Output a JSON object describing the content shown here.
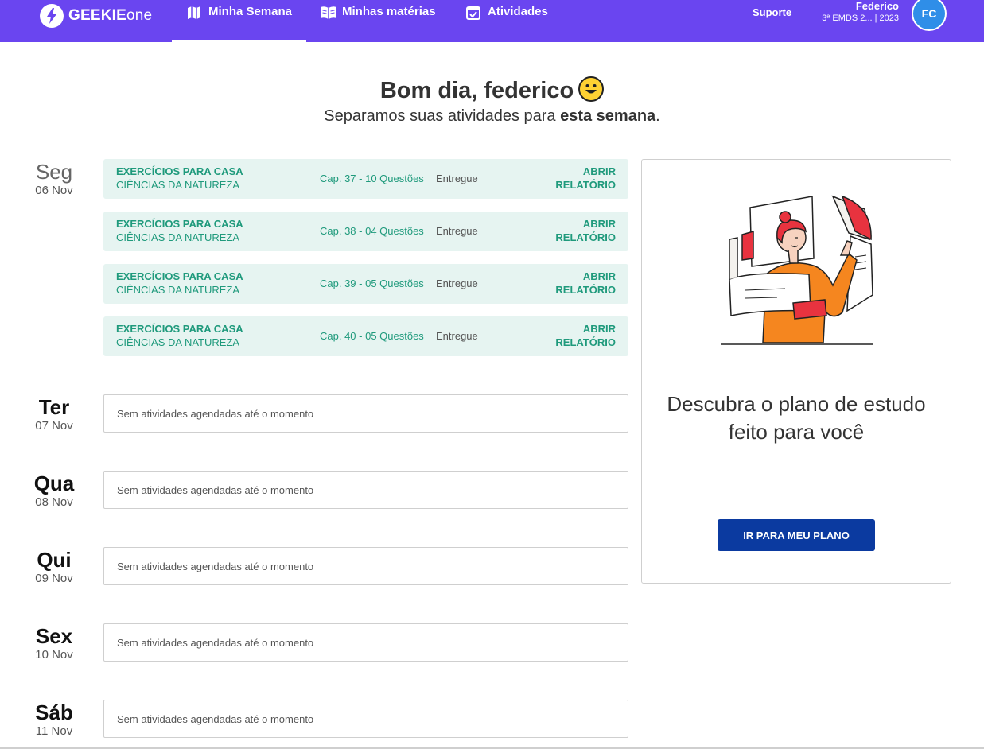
{
  "header": {
    "logo_bold": "GEEKIE",
    "logo_light": "one",
    "nav": [
      {
        "label": "Minha Semana",
        "icon": "map-icon",
        "active": true
      },
      {
        "label": "Minhas matérias",
        "icon": "book-icon",
        "active": false
      },
      {
        "label": "Atividades",
        "icon": "calendar-check-icon",
        "active": false
      }
    ],
    "support_label": "Suporte",
    "user_name": "Federico",
    "user_class": "3ª EMDS 2...   | 2023",
    "avatar_initials": "FC",
    "colors": {
      "bar": "#6a45f0",
      "avatar": "#2f8ee8"
    }
  },
  "greeting": {
    "title": "Bom dia, federico",
    "subtitle_prefix": "Separamos suas atividades para ",
    "subtitle_bold": "esta semana",
    "subtitle_suffix": "."
  },
  "days": [
    {
      "name": "Seg",
      "date": "06 Nov"
    },
    {
      "name": "Ter",
      "date": "07 Nov"
    },
    {
      "name": "Qua",
      "date": "08 Nov"
    },
    {
      "name": "Qui",
      "date": "09 Nov"
    },
    {
      "name": "Sex",
      "date": "10 Nov"
    },
    {
      "name": "Sáb",
      "date": "11 Nov"
    }
  ],
  "activities": [
    {
      "type": "EXERCÍCIOS PARA CASA",
      "subject": "CIÊNCIAS DA NATUREZA",
      "chapter": "Cap. 37 - 10 Questões",
      "status": "Entregue",
      "action_line1": "ABRIR",
      "action_line2": "RELATÓRIO"
    },
    {
      "type": "EXERCÍCIOS PARA CASA",
      "subject": "CIÊNCIAS DA NATUREZA",
      "chapter": "Cap. 38 - 04 Questões",
      "status": "Entregue",
      "action_line1": "ABRIR",
      "action_line2": "RELATÓRIO"
    },
    {
      "type": "EXERCÍCIOS PARA CASA",
      "subject": "CIÊNCIAS DA NATUREZA",
      "chapter": "Cap. 39 - 05 Questões",
      "status": "Entregue",
      "action_line1": "ABRIR",
      "action_line2": "RELATÓRIO"
    },
    {
      "type": "EXERCÍCIOS PARA CASA",
      "subject": "CIÊNCIAS DA NATUREZA",
      "chapter": "Cap. 40 - 05 Questões",
      "status": "Entregue",
      "action_line1": "ABRIR",
      "action_line2": "RELATÓRIO"
    }
  ],
  "empty_message": "Sem atividades agendadas até o momento",
  "plan_panel": {
    "title_line1": "Descubra o plano de estudo",
    "title_line2": "feito para você",
    "button_label": "IR PARA MEU PLANO",
    "button_color": "#0b3aa0"
  }
}
